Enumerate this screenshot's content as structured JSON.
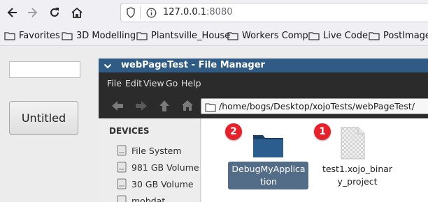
{
  "browser": {
    "url_host": "127.0.0.1",
    "url_port": ":8080",
    "icons": [
      "back-icon",
      "forward-icon",
      "reload-icon",
      "home-icon",
      "shield-icon",
      "info-icon"
    ]
  },
  "bookmarks": [
    "Favorites",
    "3D Modelling",
    "Plantsville_House",
    "Workers Comp",
    "Live Code",
    "PostImage"
  ],
  "page": {
    "button_label": "Untitled",
    "input_value": ""
  },
  "file_manager": {
    "title": "webPageTest - File Manager",
    "menu": [
      "File",
      "Edit",
      "View",
      "Go",
      "Help"
    ],
    "path": "/home/bogs/Desktop/xojoTests/webPageTest/",
    "devices_header": "DEVICES",
    "devices": [
      "File System",
      "981 GB Volume",
      "30 GB Volume",
      "mobdat"
    ],
    "items": [
      {
        "label_line1": "DebugMyApplica",
        "label_line2": "tion",
        "badge": "2",
        "type": "folder",
        "selected": true
      },
      {
        "label_line1": "test1.xojo_binar",
        "label_line2": "y_project",
        "badge": "1",
        "type": "file",
        "selected": false
      }
    ]
  },
  "colors": {
    "title_bar": "#2f5b85",
    "selection": "#536d88",
    "badge": "#e8202a"
  }
}
